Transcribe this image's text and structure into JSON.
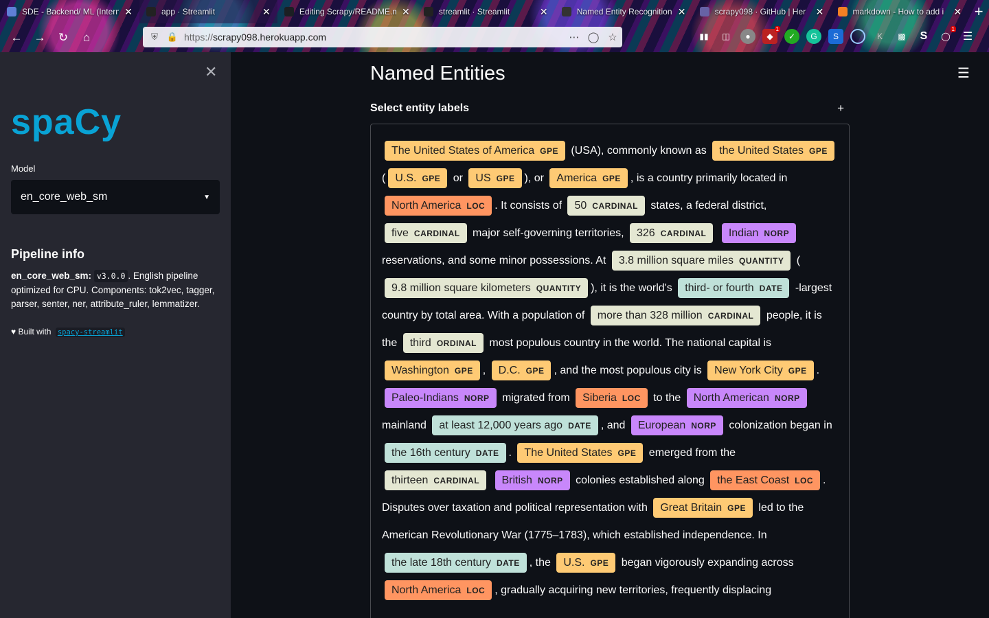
{
  "browser": {
    "tabs": [
      {
        "title": "SDE - Backend/ ML (Intern",
        "favicon_color": "#5f7fd6",
        "active": false
      },
      {
        "title": "app · Streamlit",
        "favicon_color": "#222222",
        "active": true
      },
      {
        "title": "Editing Scrapy/README.m",
        "favicon_color": "#1b1f23",
        "active": false
      },
      {
        "title": "streamlit · Streamlit",
        "favicon_color": "#222222",
        "active": false
      },
      {
        "title": "Named Entity Recognition",
        "favicon_color": "#333333",
        "active": false
      },
      {
        "title": "scrapy098 · GitHub | Her",
        "favicon_color": "#6762a6",
        "active": false
      },
      {
        "title": "markdown - How to add i",
        "favicon_color": "#f48024",
        "active": false
      }
    ],
    "url_protocol": "https://",
    "url_host": "scrapy098.herokuapp.com",
    "toolbar_icons": [
      "back-icon",
      "forward-icon",
      "reload-icon",
      "home-icon"
    ],
    "extension_badge_1": "1",
    "extension_badge_2": "1"
  },
  "sidebar": {
    "logo": "spaCy",
    "model_label": "Model",
    "model_selected": "en_core_web_sm",
    "pipeline_heading": "Pipeline info",
    "pipeline_name": "en_core_web_sm:",
    "pipeline_version": "v3.0.0",
    "pipeline_desc": ". English pipeline optimized for CPU. Components: tok2vec, tagger, parser, senter, ner, attribute_ruler, lemmatizer.",
    "built_with": "♥ Built with",
    "built_link": "spacy-streamlit"
  },
  "main": {
    "title": "Named Entities",
    "expander_label": "Select entity labels",
    "expander_icon": "+"
  },
  "entity_colors": {
    "GPE": "#feca74",
    "LOC": "#ff9561",
    "CARDINAL": "#e4e7d2",
    "NORP": "#c887fb",
    "QUANTITY": "#e4e7d2",
    "DATE": "#bfe1d9",
    "ORDINAL": "#e4e7d2"
  },
  "doc_segments": [
    {
      "ent": "The United States of America",
      "label": "GPE"
    },
    {
      "text": " (USA), commonly known as "
    },
    {
      "ent": "the United States",
      "label": "GPE"
    },
    {
      "text": " ("
    },
    {
      "ent": "U.S.",
      "label": "GPE"
    },
    {
      "text": " or "
    },
    {
      "ent": "US",
      "label": "GPE"
    },
    {
      "text": "), or "
    },
    {
      "ent": "America",
      "label": "GPE"
    },
    {
      "text": ", is a country primarily located in "
    },
    {
      "ent": "North America",
      "label": "LOC"
    },
    {
      "text": ". It consists of "
    },
    {
      "ent": "50",
      "label": "CARDINAL"
    },
    {
      "text": " states, a federal district, "
    },
    {
      "ent": "five",
      "label": "CARDINAL"
    },
    {
      "text": " major self-governing territories, "
    },
    {
      "ent": "326",
      "label": "CARDINAL"
    },
    {
      "text": " "
    },
    {
      "ent": "Indian",
      "label": "NORP"
    },
    {
      "text": " reservations, and some minor possessions. At "
    },
    {
      "ent": "3.8 million square miles",
      "label": "QUANTITY"
    },
    {
      "text": " ("
    },
    {
      "ent": "9.8 million square kilometers",
      "label": "QUANTITY"
    },
    {
      "text": "), it is the world's "
    },
    {
      "ent": "third- or fourth",
      "label": "DATE"
    },
    {
      "text": " -largest country by total area. With a population of "
    },
    {
      "ent": "more than 328 million",
      "label": "CARDINAL"
    },
    {
      "text": " people, it is the "
    },
    {
      "ent": "third",
      "label": "ORDINAL"
    },
    {
      "text": " most populous country in the world. The national capital is "
    },
    {
      "ent": "Washington",
      "label": "GPE"
    },
    {
      "text": ", "
    },
    {
      "ent": "D.C.",
      "label": "GPE"
    },
    {
      "text": ", and the most populous city is "
    },
    {
      "ent": "New York City",
      "label": "GPE"
    },
    {
      "text": ". "
    },
    {
      "ent": "Paleo-Indians",
      "label": "NORP"
    },
    {
      "text": " migrated from "
    },
    {
      "ent": "Siberia",
      "label": "LOC"
    },
    {
      "text": " to the "
    },
    {
      "ent": "North American",
      "label": "NORP"
    },
    {
      "text": " mainland "
    },
    {
      "ent": "at least 12,000 years ago",
      "label": "DATE"
    },
    {
      "text": ", and "
    },
    {
      "ent": "European",
      "label": "NORP"
    },
    {
      "text": " colonization began in "
    },
    {
      "ent": "the 16th century",
      "label": "DATE"
    },
    {
      "text": ". "
    },
    {
      "ent": "The United States",
      "label": "GPE"
    },
    {
      "text": " emerged from the "
    },
    {
      "ent": "thirteen",
      "label": "CARDINAL"
    },
    {
      "text": " "
    },
    {
      "ent": "British",
      "label": "NORP"
    },
    {
      "text": " colonies established along "
    },
    {
      "ent": "the East Coast",
      "label": "LOC"
    },
    {
      "text": ". Disputes over taxation and political representation with "
    },
    {
      "ent": "Great Britain",
      "label": "GPE"
    },
    {
      "text": " led to the American Revolutionary War (1775–1783), which established independence. In "
    },
    {
      "ent": "the late 18th century",
      "label": "DATE"
    },
    {
      "text": ", the "
    },
    {
      "ent": "U.S.",
      "label": "GPE"
    },
    {
      "text": " began vigorously expanding across "
    },
    {
      "ent": "North America",
      "label": "LOC"
    },
    {
      "text": ", gradually acquiring new territories, frequently displacing"
    }
  ]
}
